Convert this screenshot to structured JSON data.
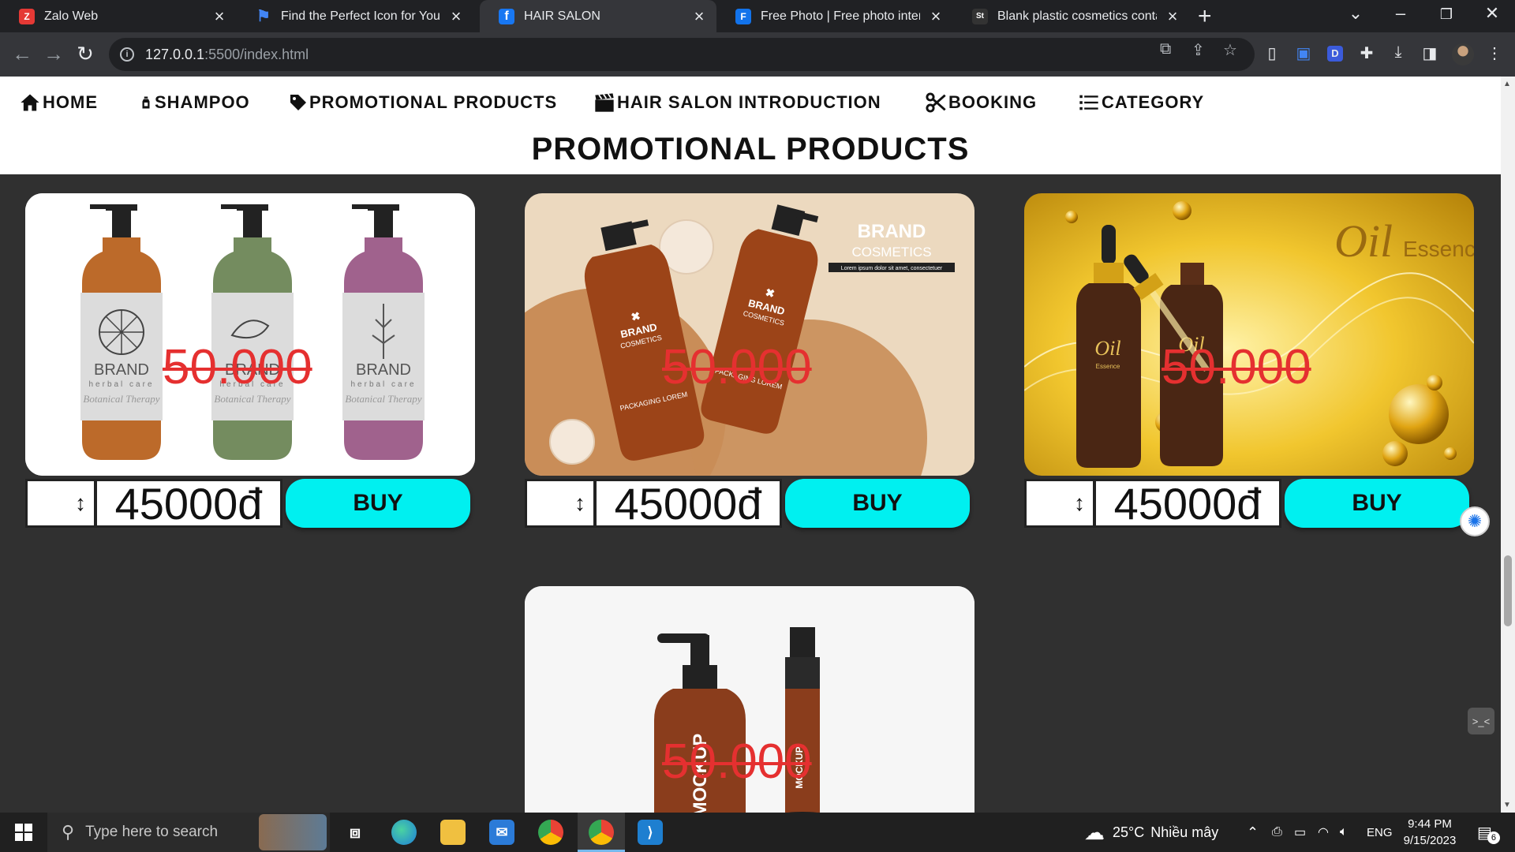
{
  "browser": {
    "tabs": [
      {
        "title": "Zalo Web",
        "favicon_color": "#e53935",
        "favicon_glyph": "Z"
      },
      {
        "title": "Find the Perfect Icon for Your Pro",
        "favicon_color": "#4285f4",
        "favicon_glyph": "⚑"
      },
      {
        "title": "HAIR SALON",
        "favicon_color": "#1877f2",
        "favicon_glyph": "f"
      },
      {
        "title": "Free Photo | Free photo interior c",
        "favicon_color": "#1273eb",
        "favicon_glyph": "F"
      },
      {
        "title": "Blank plastic cosmetics container",
        "favicon_color": "#333333",
        "favicon_glyph": "St"
      }
    ],
    "active_tab": 2,
    "url_host": "127.0.0.1",
    "url_rest": ":5500/index.html"
  },
  "nav": {
    "items": [
      {
        "label": "HOME",
        "icon": "home-icon"
      },
      {
        "label": "SHAMPOO",
        "icon": "bottle-icon"
      },
      {
        "label": "PROMOTIONAL PRODUCTS",
        "icon": "tag-icon"
      },
      {
        "label": "HAIR SALON INTRODUCTION",
        "icon": "clapperboard-icon"
      },
      {
        "label": "BOOKING",
        "icon": "scissors-icon"
      },
      {
        "label": "CATEGORY",
        "icon": "list-icon"
      }
    ]
  },
  "section_title": "PROMOTIONAL PRODUCTS",
  "products": [
    {
      "image": "three herbal shampoo pump bottles",
      "old_price": "50.000",
      "price": "45000đ",
      "qty_icon": "↕",
      "buy_label": "BUY"
    },
    {
      "image": "brown brand cosmetics bottles",
      "old_price": "50.000",
      "price": "45000đ",
      "qty_icon": "↕",
      "buy_label": "BUY"
    },
    {
      "image": "oil essence dropper bottles",
      "old_price": "50.000",
      "price": "45000đ",
      "qty_icon": "↕",
      "buy_label": "BUY"
    },
    {
      "image": "mockup pump bottle and serum",
      "old_price": "50.000"
    }
  ],
  "product_images": {
    "p1": {
      "brand": "BRAND",
      "sub": "herbal care",
      "script": "Botanical Therapy"
    },
    "p2": {
      "brand": "BRAND",
      "sub": "COSMETICS",
      "tag": "Lorem ipsum dolor sit amet, consectetuer",
      "bottle_brand": "BRAND",
      "bottle_sub": "COSMETICS",
      "bottle_pack": "PACKAGING LOREM"
    },
    "p3": {
      "title": "Oil",
      "title2": "Essence",
      "label": "Oil",
      "label_sub": "Essence"
    },
    "p4": {
      "label": "MOCKUP",
      "label2": "MOCKUP"
    }
  },
  "taskbar": {
    "search_placeholder": "Type here to search",
    "weather_temp": "25°C",
    "weather_desc": "Nhiều mây",
    "lang": "ENG",
    "time": "9:44 PM",
    "date": "9/15/2023",
    "notif_count": "6"
  }
}
